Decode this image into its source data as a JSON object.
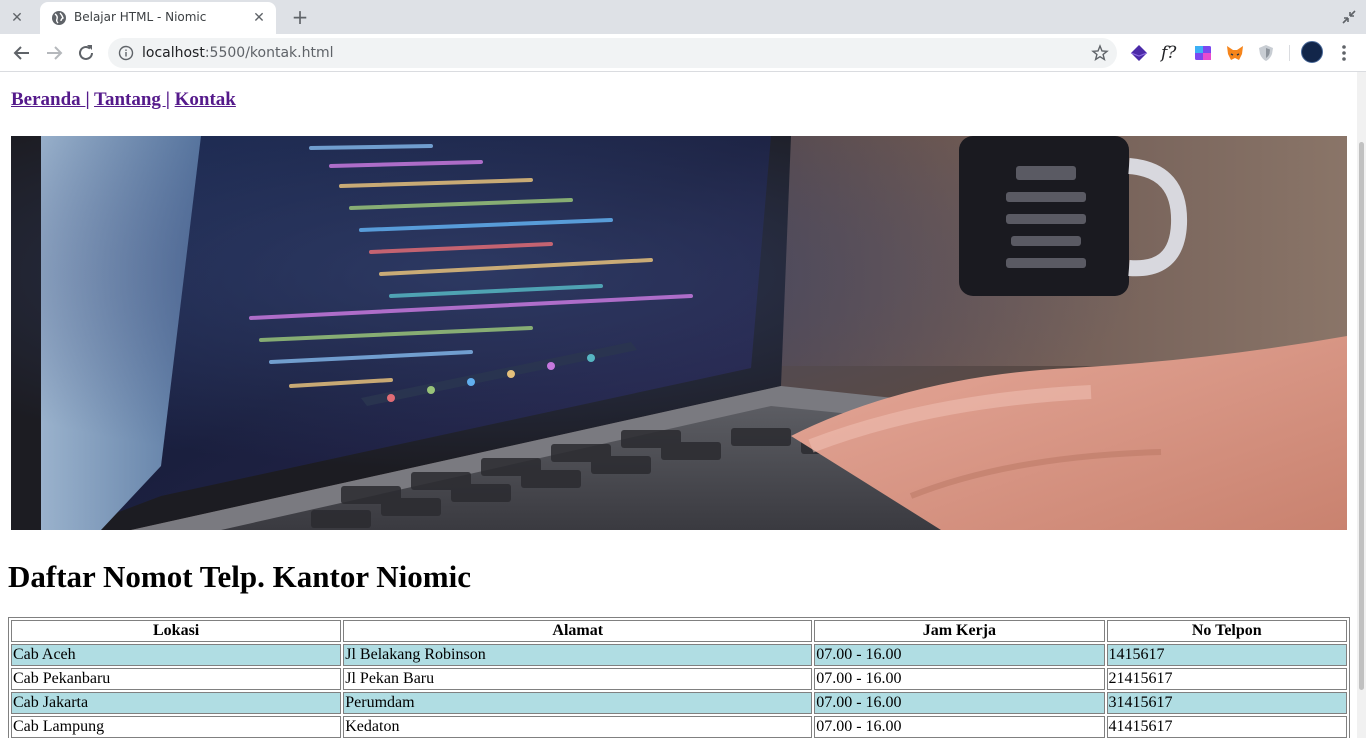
{
  "browser": {
    "tab_title": "Belajar HTML - Niomic",
    "url_host": "localhost",
    "url_rest": ":5500/kontak.html",
    "icons": {
      "close_left": "close-icon",
      "favicon": "globe-icon",
      "tab_close": "close-icon",
      "new_tab": "plus-icon",
      "restore": "restore-window-icon",
      "back": "back-arrow-icon",
      "forward": "forward-arrow-icon",
      "reload": "reload-icon",
      "info": "info-icon",
      "star": "star-icon",
      "extensions": [
        "purple-cube-extension-icon",
        "fonts-ninja-extension-icon",
        "window-resizer-extension-icon",
        "metamask-fox-extension-icon",
        "shield-extension-icon"
      ],
      "profile": "profile-avatar",
      "menu": "kebab-menu-icon"
    },
    "extension_texts": {
      "fonts": "f?"
    }
  },
  "page": {
    "nav": {
      "beranda": "Beranda ",
      "sep1": "|",
      "tantang": "Tantang ",
      "sep2": "|",
      "kontak": "Kontak"
    },
    "heading": "Daftar Nomot Telp. Kantor Niomic",
    "table": {
      "headers": [
        "Lokasi",
        "Alamat",
        "Jam Kerja",
        "No Telpon"
      ],
      "rows": [
        [
          "Cab Aceh",
          "Jl Belakang Robinson",
          "07.00 - 16.00",
          "1415617"
        ],
        [
          "Cab Pekanbaru",
          "Jl Pekan Baru",
          "07.00 - 16.00",
          "21415617"
        ],
        [
          "Cab Jakarta",
          "Perumdam",
          "07.00 - 16.00",
          "31415617"
        ],
        [
          "Cab Lampung",
          "Kedaton",
          "07.00 - 16.00",
          "41415617"
        ]
      ]
    },
    "colors": {
      "link": "#551a8b",
      "alt_row": "#b0dde3"
    }
  }
}
